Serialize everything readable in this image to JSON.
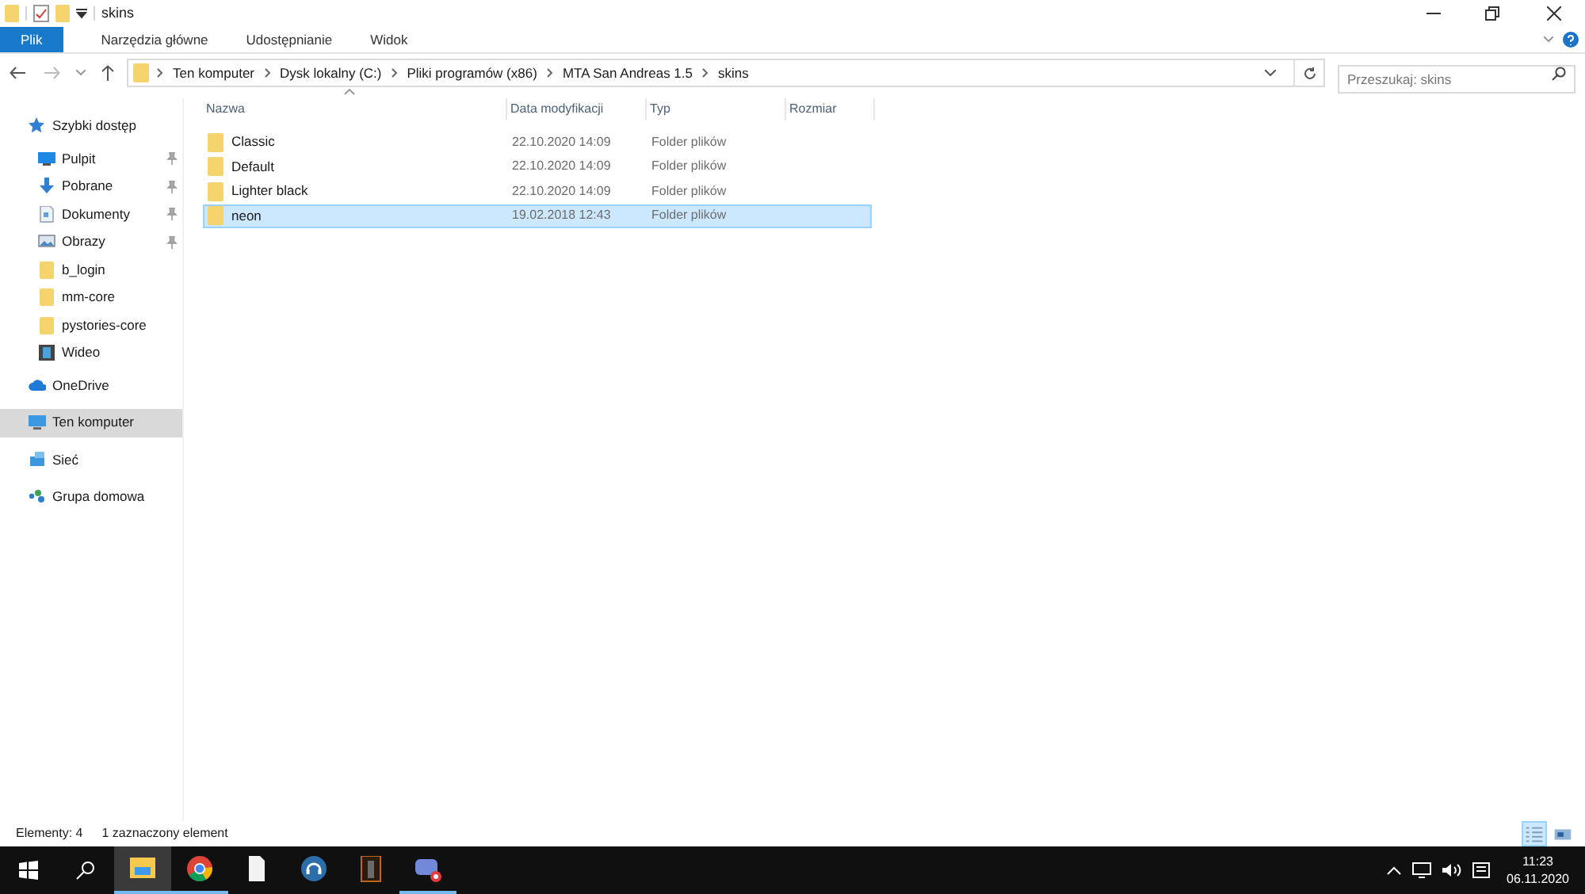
{
  "window": {
    "title": "skins"
  },
  "ribbon_tabs": [
    {
      "label": "Plik",
      "selected": true
    },
    {
      "label": "Narzędzia główne",
      "selected": false
    },
    {
      "label": "Udostępnianie",
      "selected": false
    },
    {
      "label": "Widok",
      "selected": false
    }
  ],
  "breadcrumb": [
    "Ten komputer",
    "Dysk lokalny (C:)",
    "Pliki programów (x86)",
    "MTA San Andreas 1.5",
    "skins"
  ],
  "search": {
    "placeholder": "Przeszukaj: skins"
  },
  "sidebar": {
    "items": [
      {
        "label": "Szybki dostęp",
        "kind": "star",
        "pinned": false,
        "selected": false,
        "group": true
      },
      {
        "label": "Pulpit",
        "kind": "desktop",
        "pinned": true,
        "selected": false,
        "group": false
      },
      {
        "label": "Pobrane",
        "kind": "download",
        "pinned": true,
        "selected": false,
        "group": false
      },
      {
        "label": "Dokumenty",
        "kind": "document",
        "pinned": true,
        "selected": false,
        "group": false
      },
      {
        "label": "Obrazy",
        "kind": "pictures",
        "pinned": true,
        "selected": false,
        "group": false
      },
      {
        "label": "b_login",
        "kind": "folder",
        "pinned": false,
        "selected": false,
        "group": false
      },
      {
        "label": "mm-core",
        "kind": "folder",
        "pinned": false,
        "selected": false,
        "group": false
      },
      {
        "label": "pystories-core",
        "kind": "folder",
        "pinned": false,
        "selected": false,
        "group": false
      },
      {
        "label": "Wideo",
        "kind": "video",
        "pinned": false,
        "selected": false,
        "group": false
      },
      {
        "label": "OneDrive",
        "kind": "cloud",
        "pinned": false,
        "selected": false,
        "group": true
      },
      {
        "label": "Ten komputer",
        "kind": "computer",
        "pinned": false,
        "selected": true,
        "group": true
      },
      {
        "label": "Sieć",
        "kind": "network",
        "pinned": false,
        "selected": false,
        "group": true
      },
      {
        "label": "Grupa domowa",
        "kind": "homegroup",
        "pinned": false,
        "selected": false,
        "group": true
      }
    ]
  },
  "table": {
    "columns": [
      "Nazwa",
      "Data modyfikacji",
      "Typ",
      "Rozmiar"
    ],
    "rows": [
      {
        "name": "Classic",
        "modified": "22.10.2020 14:09",
        "type": "Folder plików",
        "selected": false
      },
      {
        "name": "Default",
        "modified": "22.10.2020 14:09",
        "type": "Folder plików",
        "selected": false
      },
      {
        "name": "Lighter black",
        "modified": "22.10.2020 14:09",
        "type": "Folder plików",
        "selected": false
      },
      {
        "name": "neon",
        "modified": "19.02.2018 12:43",
        "type": "Folder plików",
        "selected": true
      }
    ]
  },
  "status_bar": {
    "count": "Elementy: 4",
    "selection": "1 zaznaczony element"
  },
  "view_buttons": [
    {
      "kind": "details",
      "selected": true
    },
    {
      "kind": "tiles",
      "selected": false
    }
  ],
  "taskbar": {
    "apps": [
      {
        "kind": "explorer",
        "running": true,
        "active": true
      },
      {
        "kind": "chrome",
        "running": true,
        "active": false
      },
      {
        "kind": "file",
        "running": false,
        "active": false
      },
      {
        "kind": "headset",
        "running": false,
        "active": false
      },
      {
        "kind": "portrait",
        "running": false,
        "active": false
      },
      {
        "kind": "chat",
        "running": true,
        "active": false
      }
    ],
    "time": "11:23",
    "date": "06.11.2020"
  }
}
